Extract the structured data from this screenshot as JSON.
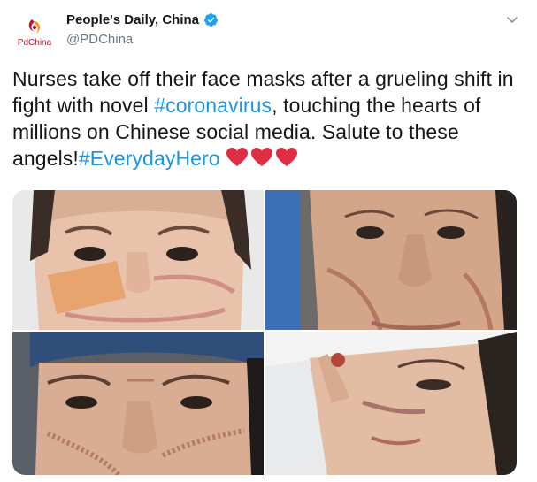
{
  "account": {
    "display_name": "People's Daily, China",
    "handle": "@PDChina",
    "avatar_wordmark": "PdChina",
    "verified": true
  },
  "tweet": {
    "text_before_tag1": "Nurses take off their face masks after a grueling shift in fight with novel ",
    "hashtag1": "#coronavirus",
    "text_middle": ", touching the hearts of millions on Chinese social media. Salute to these angels!",
    "hashtag2": "#EverydayHero",
    "emoji": [
      "red-heart",
      "red-heart",
      "red-heart"
    ]
  },
  "media": {
    "photos": [
      {
        "subject": "nurse-face-with-bandage"
      },
      {
        "subject": "nurse-face-with-mask-marks"
      },
      {
        "subject": "nurse-face-with-cap-and-marks"
      },
      {
        "subject": "nurse-face-with-bruised-nose"
      }
    ]
  },
  "colors": {
    "link": "#1b95e0",
    "name": "#14171a",
    "secondary": "#657786",
    "verified": "#1da1f2",
    "heart": "#dd2e44",
    "brand_red": "#c8102e"
  }
}
